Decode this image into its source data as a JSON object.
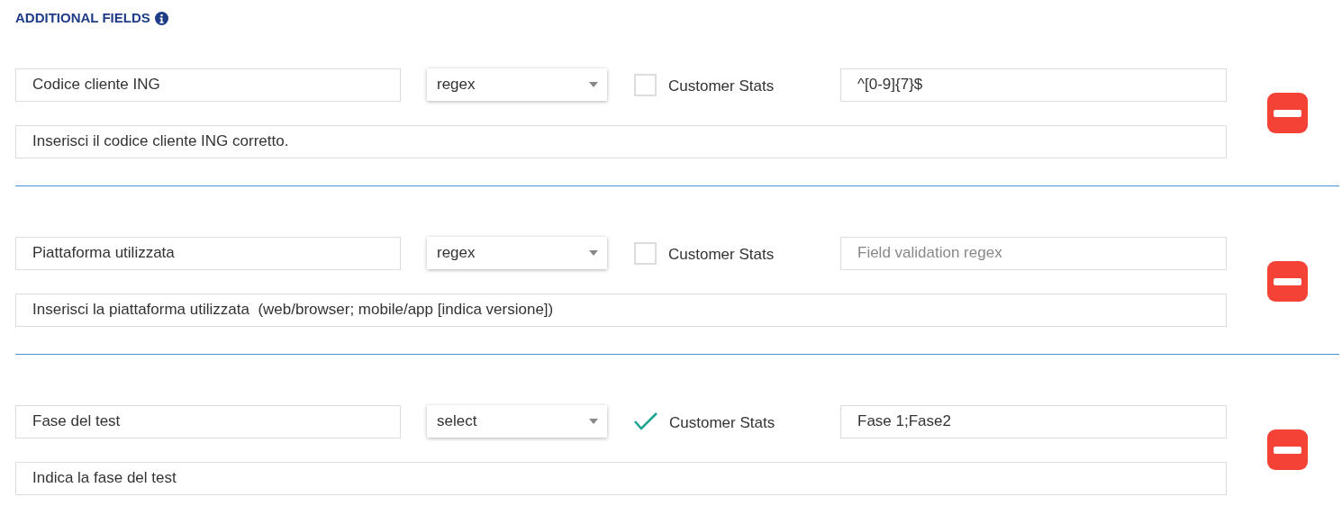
{
  "title": "ADDITIONAL FIELDS",
  "fields": [
    {
      "name": "Codice cliente ING",
      "type": "regex",
      "customer_stats": {
        "label": "Customer Stats",
        "checked": false
      },
      "validation": {
        "value": "^[0-9]{7}$"
      },
      "description": "Inserisci il codice cliente ING corretto."
    },
    {
      "name": "Piattaforma utilizzata",
      "type": "regex",
      "customer_stats": {
        "label": "Customer Stats",
        "checked": false
      },
      "validation": {
        "placeholder": "Field validation regex"
      },
      "description": "Inserisci la piattaforma utilizzata  (web/browser; mobile/app [indica versione])"
    },
    {
      "name": "Fase del test",
      "type": "select",
      "customer_stats": {
        "label": "Customer Stats",
        "checked": true
      },
      "validation": {
        "value": "Fase 1;Fase2"
      },
      "description": "Indica la fase del test"
    }
  ]
}
